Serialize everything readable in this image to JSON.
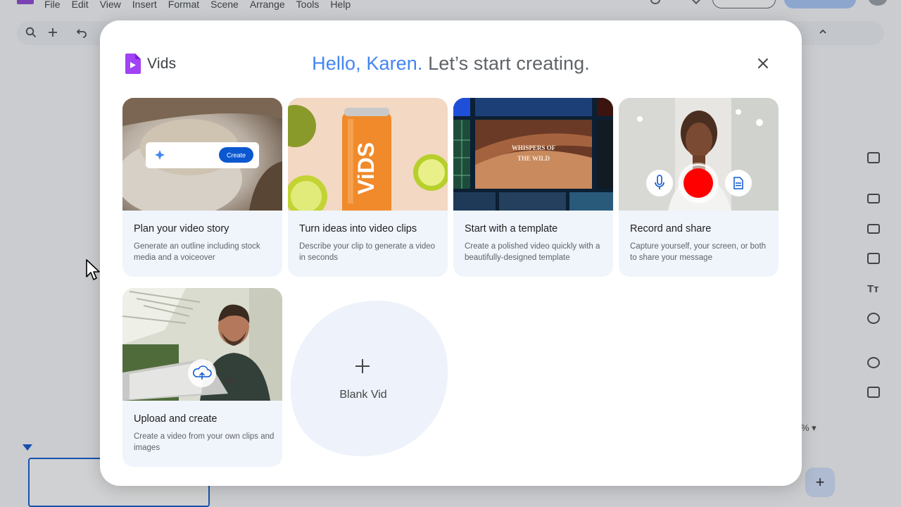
{
  "background": {
    "menu": [
      "File",
      "Edit",
      "View",
      "Insert",
      "Format",
      "Scene",
      "Arrange",
      "Tools",
      "Help"
    ],
    "zoom_suffix": "%",
    "add_scene_symbol": "+",
    "toolbar_icons": [
      "search-icon",
      "add-icon",
      "undo-icon"
    ],
    "rail_icons": [
      "image-icon",
      "caption-icon",
      "folder-icon",
      "media-icon",
      "text-icon",
      "shapes-icon",
      "record-icon",
      "import-icon"
    ]
  },
  "dialog": {
    "brand": "Vids",
    "greeting_hello": "Hello, Karen.",
    "greeting_rest": " Let’s start creating.",
    "close_icon": "close-icon",
    "cards": [
      {
        "title": "Plan your video story",
        "desc": "Generate an outline including stock media and a voiceover",
        "thumb_button": "Create"
      },
      {
        "title": "Turn ideas into video clips",
        "desc": "Describe your clip to generate a video in seconds",
        "can_text": "ViDS"
      },
      {
        "title": "Start with a template",
        "desc": "Create a polished video quickly with a beautifully-designed template",
        "thumb_text_1": "WHISPERS OF",
        "thumb_text_2": "THE WILD"
      },
      {
        "title": "Record and share",
        "desc": "Capture yourself, your screen, or both to share your message"
      },
      {
        "title": "Upload and create",
        "desc": "Create a video from your own clips and images"
      }
    ],
    "blank": {
      "label": "Blank Vid"
    }
  },
  "colors": {
    "hello_blue": "#4285f4",
    "brand_purple": "#8e44d6",
    "record_red": "#ff0000",
    "card_bg": "#f0f4fb"
  }
}
